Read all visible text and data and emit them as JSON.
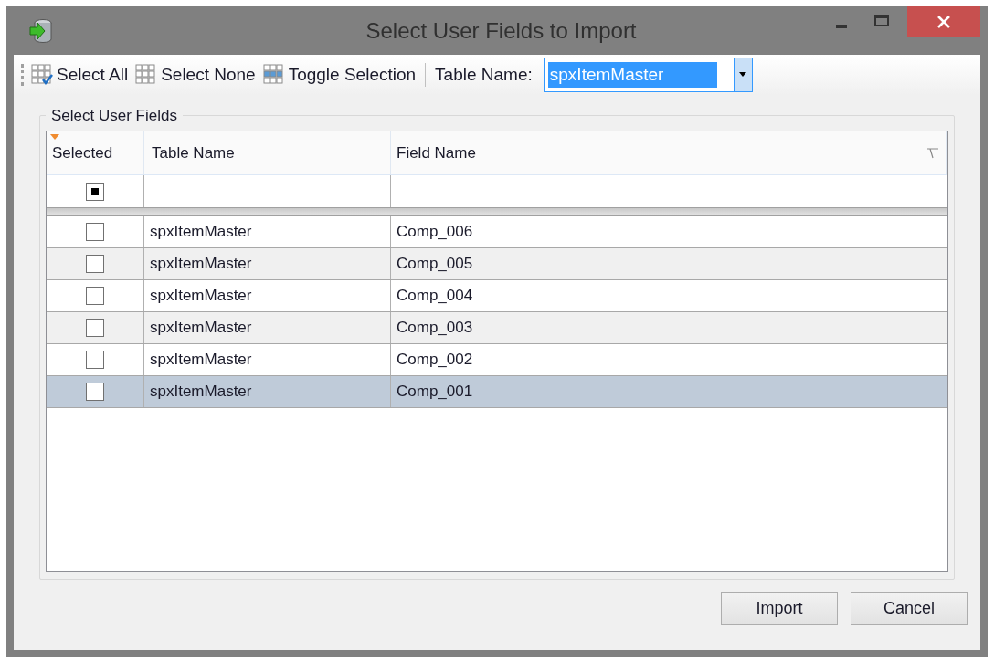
{
  "window": {
    "title": "Select User Fields to Import"
  },
  "toolbar": {
    "buttons": [
      {
        "kind": "select-all",
        "label": "Select All"
      },
      {
        "kind": "select-none",
        "label": "Select None"
      },
      {
        "kind": "toggle",
        "label": "Toggle Selection"
      }
    ],
    "table_name_label": "Table Name:",
    "table_name_value": "spxItemMaster"
  },
  "group": {
    "title": "Select User Fields"
  },
  "table": {
    "columns": [
      "Selected",
      "Table Name",
      "Field Name"
    ],
    "filter_row": {
      "indeterminate": true
    },
    "rows": [
      {
        "checked": false,
        "selected": false,
        "table_name": "spxItemMaster",
        "field_name": "Comp_006"
      },
      {
        "checked": false,
        "selected": false,
        "table_name": "spxItemMaster",
        "field_name": "Comp_005"
      },
      {
        "checked": false,
        "selected": false,
        "table_name": "spxItemMaster",
        "field_name": "Comp_004"
      },
      {
        "checked": false,
        "selected": false,
        "table_name": "spxItemMaster",
        "field_name": "Comp_003"
      },
      {
        "checked": false,
        "selected": false,
        "table_name": "spxItemMaster",
        "field_name": "Comp_002"
      },
      {
        "checked": false,
        "selected": true,
        "table_name": "spxItemMaster",
        "field_name": "Comp_001"
      }
    ]
  },
  "buttons": [
    "Import",
    "Cancel"
  ]
}
